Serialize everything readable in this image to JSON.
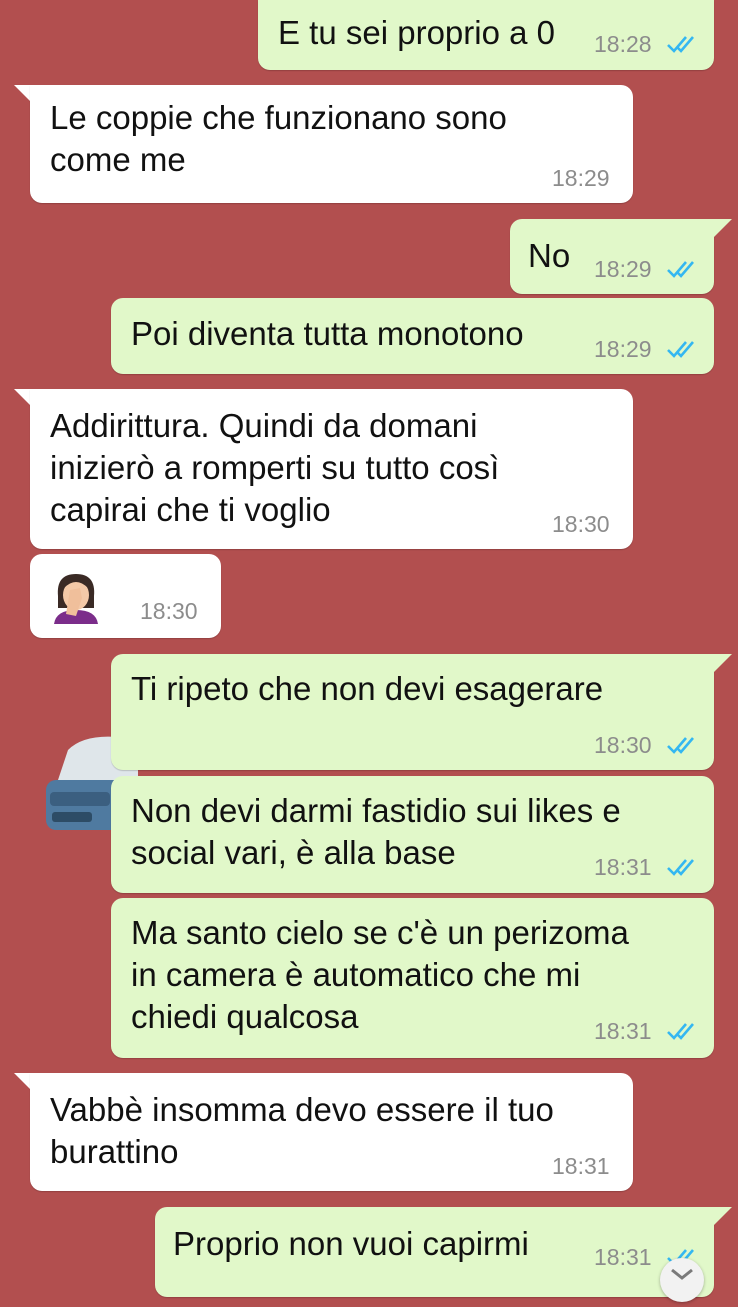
{
  "colors": {
    "background": "#b24f4f",
    "outgoing_bubble": "#e1f8c9",
    "incoming_bubble": "#ffffff",
    "read_tick": "#34b7f1",
    "timestamp": "#8c8c8c"
  },
  "messages": [
    {
      "direction": "out",
      "text": "E tu sei proprio a 0",
      "time": "18:28",
      "status": "read"
    },
    {
      "direction": "in",
      "text": "Le coppie che funzionano sono\ncome me",
      "time": "18:29"
    },
    {
      "direction": "out",
      "text": "No",
      "time": "18:29",
      "status": "read"
    },
    {
      "direction": "out",
      "text": "Poi diventa tutta monotono",
      "time": "18:29",
      "status": "read"
    },
    {
      "direction": "in",
      "text": "Addirittura. Quindi da domani\ninizierò a romperti su tutto così\ncapirai che ti voglio",
      "time": "18:30"
    },
    {
      "direction": "in",
      "emoji": "woman-facepalming-icon",
      "time": "18:30"
    },
    {
      "direction": "out",
      "text": "Ti ripeto che non devi esagerare",
      "time": "18:30",
      "status": "read"
    },
    {
      "direction": "out",
      "text": "Non devi darmi fastidio sui likes e\nsocial vari, è alla base",
      "time": "18:31",
      "status": "read"
    },
    {
      "direction": "out",
      "text": "Ma santo cielo se c'è un perizoma\nin camera è automatico che mi\nchiedi qualcosa",
      "time": "18:31",
      "status": "read"
    },
    {
      "direction": "in",
      "text": "Vabbè insomma devo essere il tuo\nburattino",
      "time": "18:31"
    },
    {
      "direction": "out",
      "text": "Proprio non vuoi capirmi",
      "time": "18:31",
      "status": "read"
    }
  ],
  "scroll_down_icon": "chevron-down-icon"
}
